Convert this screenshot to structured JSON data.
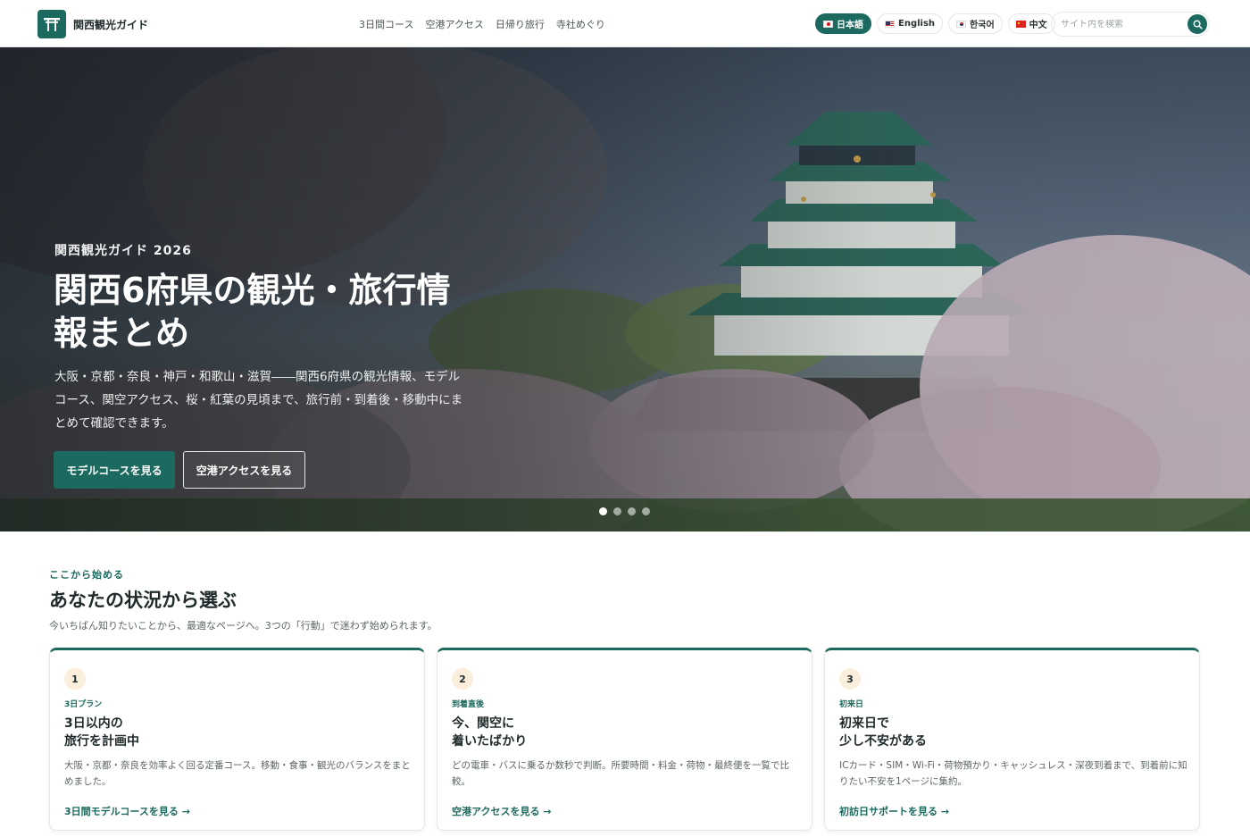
{
  "header": {
    "logo_text": "関西観光ガイド",
    "nav": [
      "3日間コース",
      "空港アクセス",
      "日帰り旅行",
      "寺社めぐり"
    ],
    "languages": [
      {
        "label": "日本語",
        "active": true
      },
      {
        "label": "English",
        "active": false
      },
      {
        "label": "한국어",
        "active": false
      },
      {
        "label": "中文",
        "active": false
      }
    ],
    "search_placeholder": "サイト内を検索"
  },
  "hero": {
    "kicker": "関西観光ガイド 2026",
    "title": "関西6府県の観光・旅行情報まとめ",
    "description": "大阪・京都・奈良・神戸・和歌山・滋賀――関西6府県の観光情報、モデルコース、関空アクセス、桜・紅葉の見頃まで、旅行前・到着後・移動中にまとめて確認できます。",
    "primary_button": "モデルコースを見る",
    "secondary_button": "空港アクセスを見る",
    "slides": 4,
    "active_slide": 1
  },
  "section": {
    "kicker": "ここから始める",
    "title": "あなたの状況から選ぶ",
    "description": "今いちばん知りたいことから、最適なページへ。3つの「行動」で迷わず始められます。",
    "cards": [
      {
        "number": "1",
        "tag": "3日プラン",
        "title_line1": "3日以内の",
        "title_line2": "旅行を計画中",
        "description": "大阪・京都・奈良を効率よく回る定番コース。移動・食事・観光のバランスをまとめました。",
        "link": "3日間モデルコースを見る →"
      },
      {
        "number": "2",
        "tag": "到着直後",
        "title_line1": "今、関空に",
        "title_line2": "着いたばかり",
        "description": "どの電車・バスに乗るか数秒で判断。所要時間・料金・荷物・最終便を一覧で比較。",
        "link": "空港アクセスを見る →"
      },
      {
        "number": "3",
        "tag": "初来日",
        "title_line1": "初来日で",
        "title_line2": "少し不安がある",
        "description": "ICカード・SIM・Wi-Fi・荷物預かり・キャッシュレス・深夜到着まで、到着前に知りたい不安を1ページに集約。",
        "link": "初訪日サポートを見る →"
      }
    ]
  },
  "colors": {
    "brand": "#1c6a5f",
    "accent_badge": "#fbeedd"
  }
}
